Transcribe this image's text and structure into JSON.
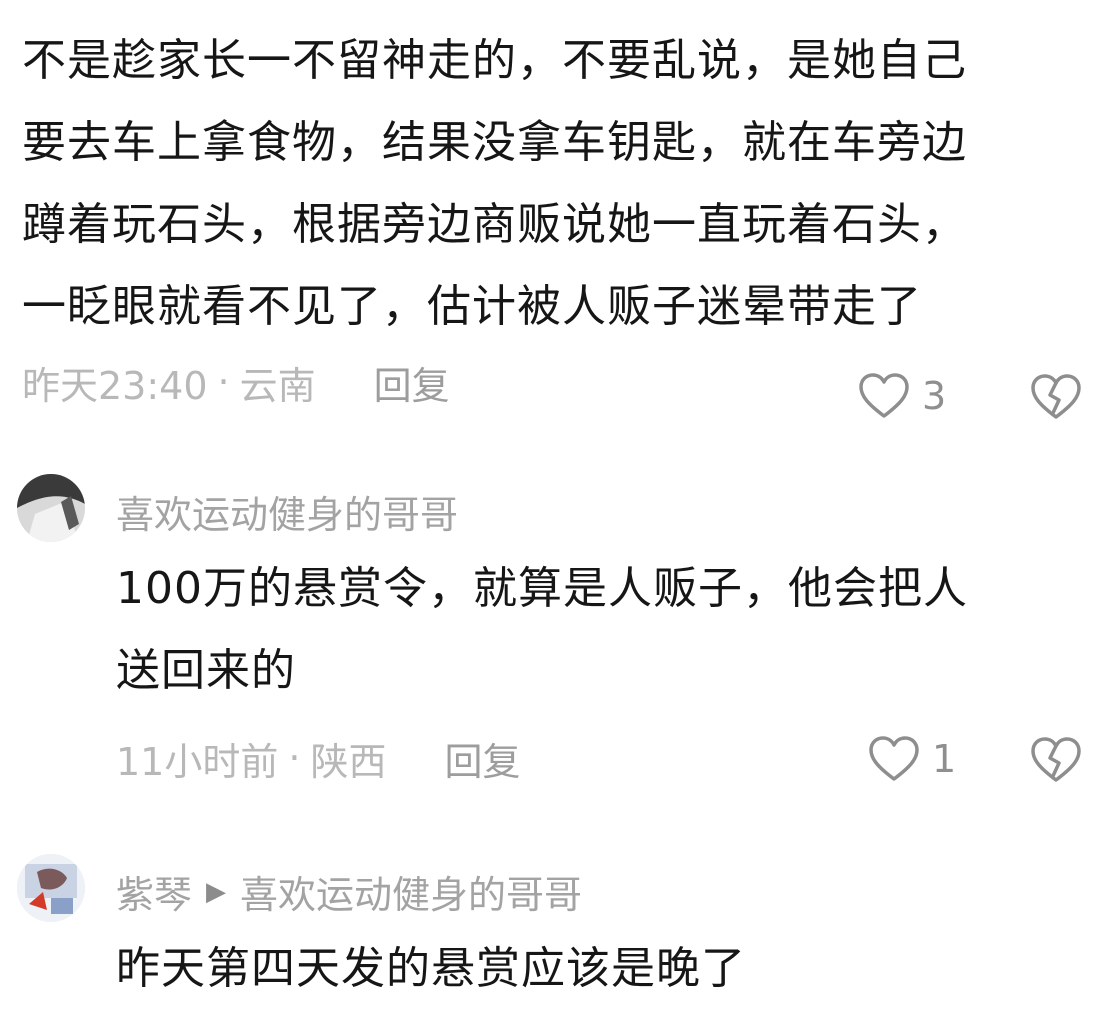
{
  "root_comment": {
    "text": "不是趁家长一不留神走的，不要乱说，是她自己\n要去车上拿食物，结果没拿车钥匙，就在车旁边\n蹲着玩石头，根据旁边商贩说她一直玩着石头，\n一眨眼就看不见了，估计被人贩子迷晕带走了",
    "time": "昨天23:40",
    "location": "云南",
    "reply_label": "回复",
    "likes": "3"
  },
  "reply1": {
    "author": "喜欢运动健身的哥哥",
    "text": "100万的悬赏令，就算是人贩子，他会把人\n送回来的",
    "time": "11小时前",
    "location": "陕西",
    "reply_label": "回复",
    "likes": "1"
  },
  "reply2": {
    "author": "紫琴",
    "reply_to": "喜欢运动健身的哥哥",
    "text": "昨天第四天发的悬赏应该是晚了"
  },
  "separator": "·",
  "icons": {
    "like": "heart-outline-icon",
    "dislike": "broken-heart-icon",
    "reply_arrow": "triangle-right-icon"
  },
  "colors": {
    "text": "#161616",
    "meta": "#b8b8b8",
    "author": "#a3a3a3",
    "icon": "#8e8e8e"
  }
}
